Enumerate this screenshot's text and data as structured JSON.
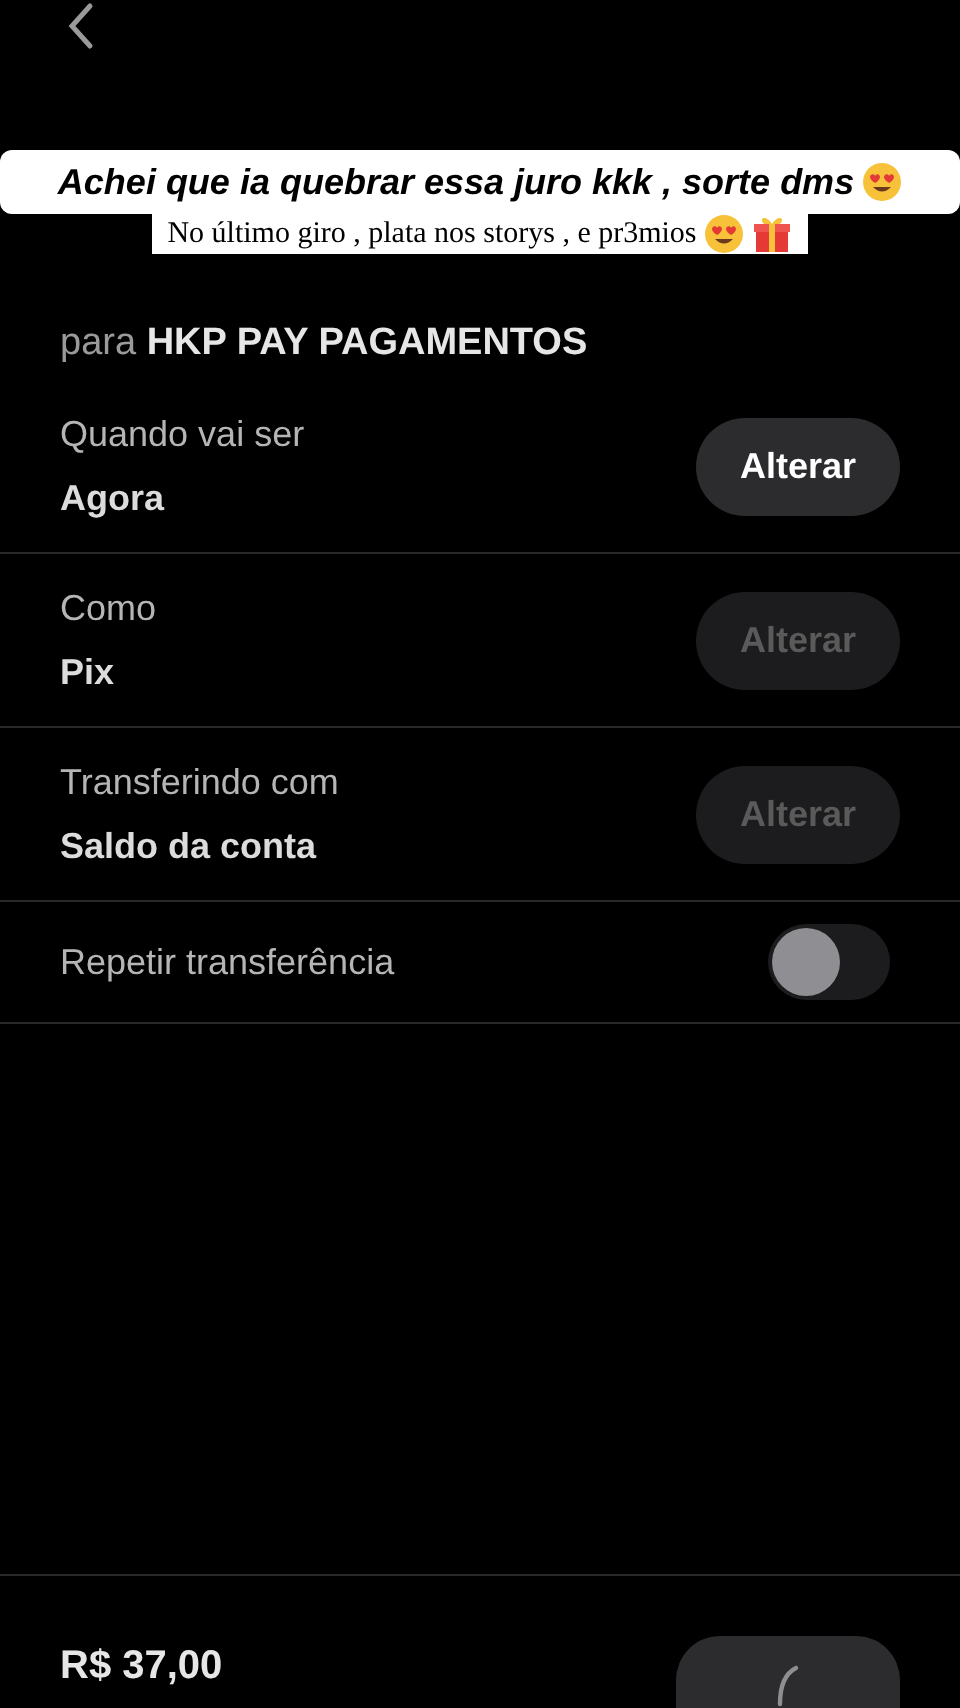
{
  "captions": [
    {
      "kind": "banner",
      "text": "Achei que ia quebrar essa juro kkk , sorte dms",
      "icons": [
        {
          "kind": "heart-eyes"
        }
      ]
    },
    {
      "kind": "subtitle",
      "text": "No último giro , plata nos storys , e pr3mios",
      "icons": [
        {
          "kind": "heart-eyes"
        },
        {
          "kind": "gift"
        }
      ]
    }
  ],
  "recipient": {
    "prefix": "para",
    "name": "HKP PAY PAGAMENTOS"
  },
  "details": [
    {
      "kind": "choice",
      "label": "Quando vai ser",
      "value": "Agora",
      "button": "Alterar",
      "disabled": false
    },
    {
      "kind": "choice",
      "label": "Como",
      "value": "Pix",
      "button": "Alterar",
      "disabled": true
    },
    {
      "kind": "choice",
      "label": "Transferindo com",
      "value": "Saldo da conta",
      "button": "Alterar",
      "disabled": true
    },
    {
      "kind": "toggle",
      "label": "Repetir transferência",
      "on": false
    }
  ],
  "footer": {
    "amount": "R$ 37,00",
    "button_loading": true
  }
}
